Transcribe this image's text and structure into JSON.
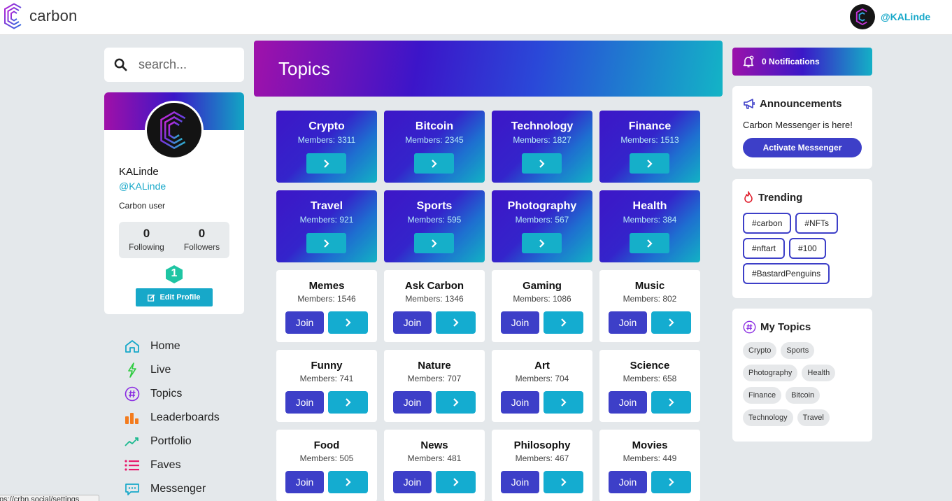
{
  "app": {
    "logo_text": "carbon",
    "user_handle": "@KALinde"
  },
  "search": {
    "placeholder": "search..."
  },
  "profile": {
    "name": "KALinde",
    "handle": "@KALinde",
    "bio": "Carbon user",
    "following_count": "0",
    "following_label": "Following",
    "followers_count": "0",
    "followers_label": "Followers",
    "level": "1",
    "edit_label": "Edit Profile"
  },
  "nav": [
    {
      "label": "Home",
      "icon": "home-icon",
      "color": "#17a8c9"
    },
    {
      "label": "Live",
      "icon": "lightning-icon",
      "color": "#2ecc40"
    },
    {
      "label": "Topics",
      "icon": "hashtag-icon",
      "color": "#8a2be2"
    },
    {
      "label": "Leaderboards",
      "icon": "bar-chart-icon",
      "color": "#f37b1d"
    },
    {
      "label": "Portfolio",
      "icon": "trend-line-icon",
      "color": "#1bb98f"
    },
    {
      "label": "Faves",
      "icon": "list-icon",
      "color": "#e8196c"
    },
    {
      "label": "Messenger",
      "icon": "chat-icon",
      "color": "#17a8c9"
    }
  ],
  "status_url": "ps://crbn.social/settings",
  "topics": {
    "title": "Topics",
    "featured": [
      {
        "name": "Crypto",
        "members": "Members: 3311"
      },
      {
        "name": "Bitcoin",
        "members": "Members: 2345"
      },
      {
        "name": "Technology",
        "members": "Members: 1827"
      },
      {
        "name": "Finance",
        "members": "Members: 1513"
      },
      {
        "name": "Travel",
        "members": "Members: 921"
      },
      {
        "name": "Sports",
        "members": "Members: 595"
      },
      {
        "name": "Photography",
        "members": "Members: 567"
      },
      {
        "name": "Health",
        "members": "Members: 384"
      }
    ],
    "others": [
      {
        "name": "Memes",
        "members": "Members: 1546"
      },
      {
        "name": "Ask Carbon",
        "members": "Members: 1346"
      },
      {
        "name": "Gaming",
        "members": "Members: 1086"
      },
      {
        "name": "Music",
        "members": "Members: 802"
      },
      {
        "name": "Funny",
        "members": "Members: 741"
      },
      {
        "name": "Nature",
        "members": "Members: 707"
      },
      {
        "name": "Art",
        "members": "Members: 704"
      },
      {
        "name": "Science",
        "members": "Members: 658"
      },
      {
        "name": "Food",
        "members": "Members: 505"
      },
      {
        "name": "News",
        "members": "Members: 481"
      },
      {
        "name": "Philosophy",
        "members": "Members: 467"
      },
      {
        "name": "Movies",
        "members": "Members: 449"
      }
    ],
    "join_label": "Join"
  },
  "notifications": {
    "label": "0 Notifications"
  },
  "announcements": {
    "title": "Announcements",
    "text": "Carbon Messenger is here!",
    "button": "Activate Messenger"
  },
  "trending": {
    "title": "Trending",
    "tags": [
      "#carbon",
      "#NFTs",
      "#nftart",
      "#100",
      "#BastardPenguins"
    ]
  },
  "my_topics": {
    "title": "My Topics",
    "items": [
      "Crypto",
      "Sports",
      "Photography",
      "Health",
      "Finance",
      "Bitcoin",
      "Technology",
      "Travel"
    ]
  },
  "colors": {
    "accent_teal": "#17a8c9",
    "accent_indigo": "#3d3fc8",
    "brand_purple": "#a010a8"
  }
}
